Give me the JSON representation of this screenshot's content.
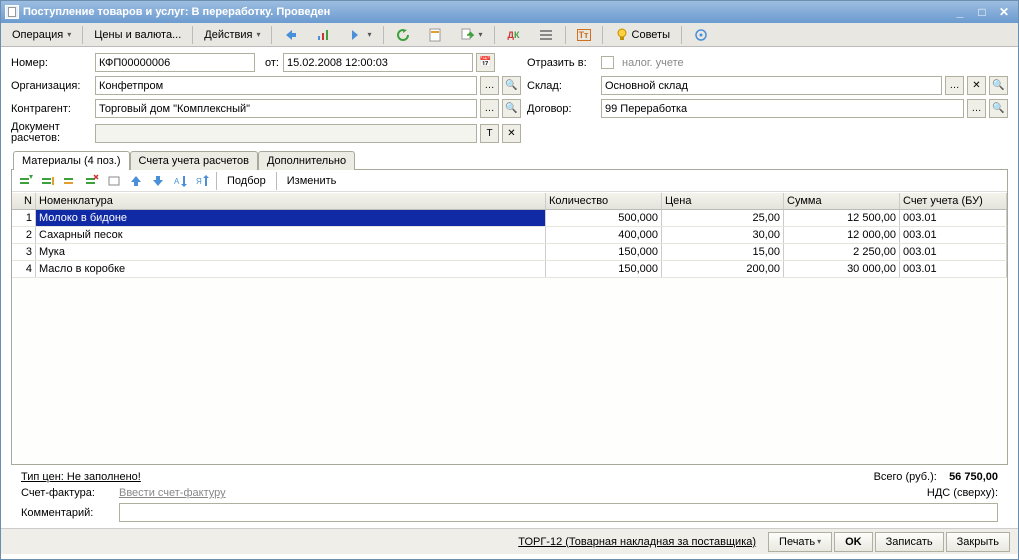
{
  "window": {
    "title": "Поступление товаров и услуг: В переработку. Проведен"
  },
  "toolbar": {
    "operation": "Операция",
    "prices": "Цены и валюта...",
    "actions": "Действия",
    "advice": "Советы"
  },
  "form": {
    "left": {
      "number_lbl": "Номер:",
      "number_val": "КФП00000006",
      "date_lbl": "от:",
      "date_val": "15.02.2008 12:00:03",
      "org_lbl": "Организация:",
      "org_val": "Конфетпром",
      "contr_lbl": "Контрагент:",
      "contr_val": "Торговый дом \"Комплексный\"",
      "docpay_lbl": "Документ расчетов:",
      "docpay_val": ""
    },
    "right": {
      "reflect_lbl": "Отразить в:",
      "reflect_chk_lbl": "налог. учете",
      "stock_lbl": "Склад:",
      "stock_val": "Основной склад",
      "contract_lbl": "Договор:",
      "contract_val": "99 Переработка"
    }
  },
  "tabs": {
    "materials": "Материалы (4 поз.)",
    "accounts": "Счета учета расчетов",
    "additional": "Дополнительно"
  },
  "minitb": {
    "pick": "Подбор",
    "change": "Изменить"
  },
  "table": {
    "headers": {
      "num": "N",
      "name": "Номенклатура",
      "qty": "Количество",
      "price": "Цена",
      "sum": "Сумма",
      "acc": "Счет учета (БУ)"
    },
    "rows": [
      {
        "num": "1",
        "name": "Молоко в бидоне",
        "qty": "500,000",
        "price": "25,00",
        "sum": "12 500,00",
        "acc": "003.01"
      },
      {
        "num": "2",
        "name": "Сахарный песок",
        "qty": "400,000",
        "price": "30,00",
        "sum": "12 000,00",
        "acc": "003.01"
      },
      {
        "num": "3",
        "name": "Мука",
        "qty": "150,000",
        "price": "15,00",
        "sum": "2 250,00",
        "acc": "003.01"
      },
      {
        "num": "4",
        "name": "Масло в коробке",
        "qty": "150,000",
        "price": "200,00",
        "sum": "30 000,00",
        "acc": "003.01"
      }
    ]
  },
  "summary": {
    "price_type_lbl": "Тип цен: Не заполнено!",
    "total_lbl": "Всего (руб.):",
    "total_val": "56 750,00",
    "invoice_lbl": "Счет-фактура:",
    "invoice_link": "Ввести счет-фактуру",
    "nds_lbl": "НДС (сверху):",
    "comment_lbl": "Комментарий:",
    "comment_val": ""
  },
  "buttons": {
    "torg": "ТОРГ-12 (Товарная накладная за поставщика)",
    "print": "Печать",
    "ok": "OK",
    "save": "Записать",
    "close": "Закрыть"
  }
}
